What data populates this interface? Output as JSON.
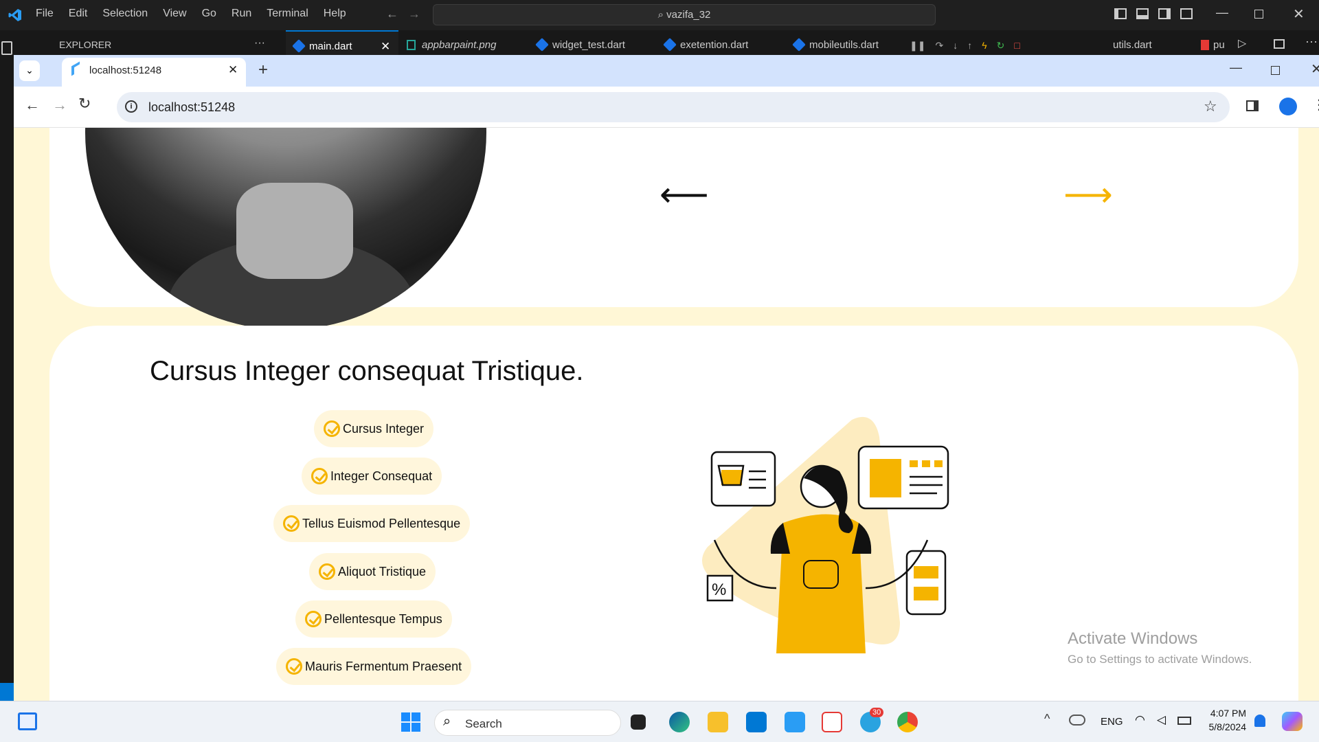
{
  "vscode": {
    "menu": [
      "File",
      "Edit",
      "Selection",
      "View",
      "Go",
      "Run",
      "Terminal",
      "Help"
    ],
    "search": "vazifa_32",
    "explorer_label": "EXPLORER",
    "explorer_more": "···",
    "tabs": [
      "main.dart",
      "appbarpaint.png",
      "widget_test.dart",
      "exetention.dart",
      "mobileutils.dart",
      "utils.dart",
      "pu"
    ]
  },
  "browser": {
    "tab_title": "localhost:51248",
    "new_tab": "+",
    "url": "localhost:51248"
  },
  "page": {
    "section_title": "Cursus Integer consequat Tristique.",
    "features": [
      "Cursus Integer",
      "Integer Consequat",
      "Tellus Euismod Pellentesque",
      "Aliquot Tristique",
      "Pellentesque Tempus",
      "Mauris Fermentum Praesent"
    ],
    "left_arrow": "⟵",
    "right_arrow": "⟶",
    "accent_color": "#f5b400"
  },
  "watermark": {
    "title": "Activate Windows",
    "subtitle": "Go to Settings to activate Windows."
  },
  "taskbar": {
    "search": "Search",
    "language": "ENG",
    "time": "4:07 PM",
    "date": "5/8/2024",
    "telegram_badge": "30"
  }
}
